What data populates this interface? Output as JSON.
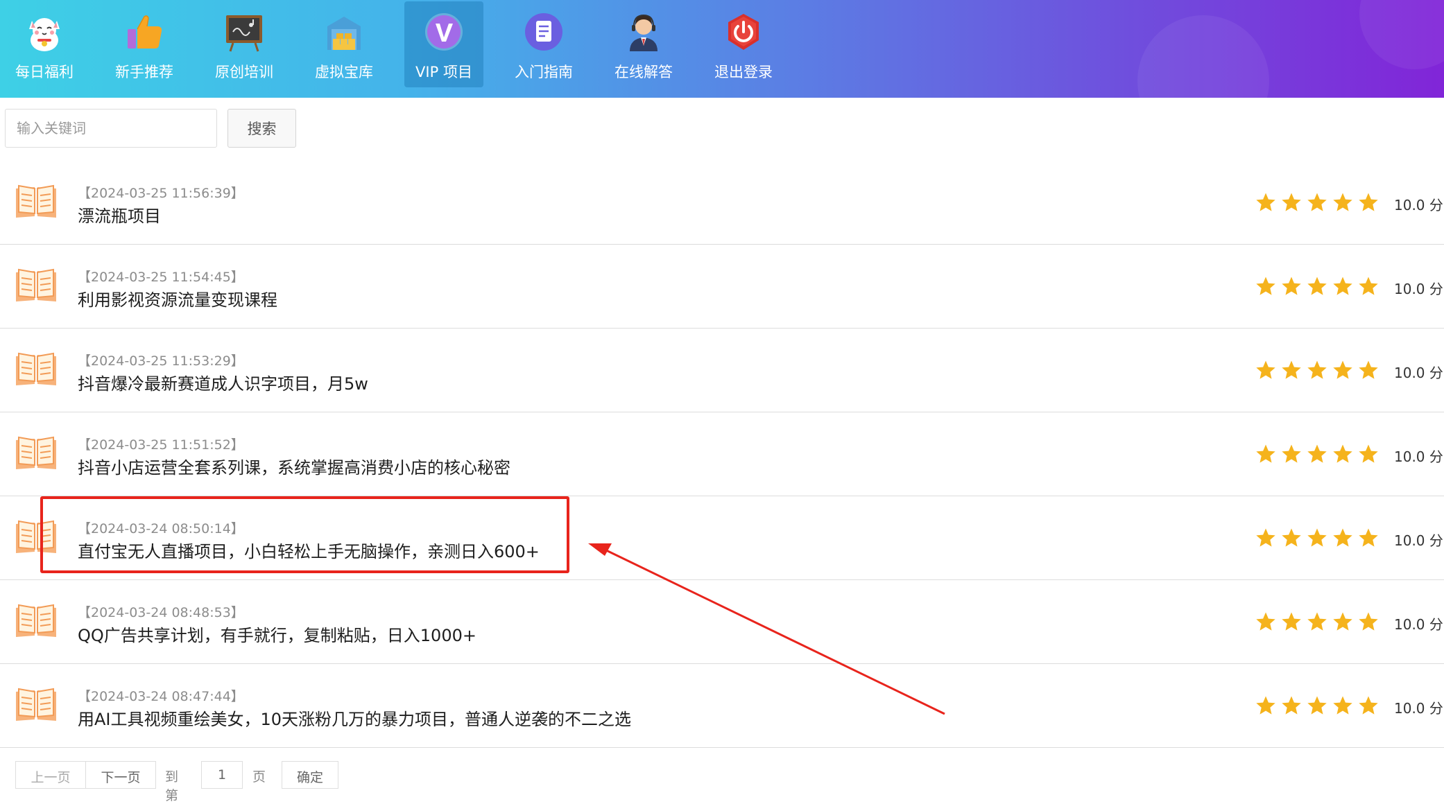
{
  "nav": {
    "items": [
      {
        "label": "每日福利",
        "icon": "lucky-cat-icon"
      },
      {
        "label": "新手推荐",
        "icon": "thumbs-up-icon"
      },
      {
        "label": "原创培训",
        "icon": "blackboard-icon"
      },
      {
        "label": "虚拟宝库",
        "icon": "warehouse-icon"
      },
      {
        "label": "VIP 项目",
        "icon": "vip-badge-icon",
        "active": true
      },
      {
        "label": "入门指南",
        "icon": "document-icon"
      },
      {
        "label": "在线解答",
        "icon": "support-agent-icon"
      },
      {
        "label": "退出登录",
        "icon": "power-icon"
      }
    ]
  },
  "search": {
    "placeholder": "输入关键词",
    "button_label": "搜索"
  },
  "list": {
    "items": [
      {
        "date": "【2024-03-25 11:56:39】",
        "title": "漂流瓶项目",
        "rating": 5,
        "score": "10.0 分"
      },
      {
        "date": "【2024-03-25 11:54:45】",
        "title": "利用影视资源流量变现课程",
        "rating": 5,
        "score": "10.0 分"
      },
      {
        "date": "【2024-03-25 11:53:29】",
        "title": "抖音爆冷最新赛道成人识字项目，月5w",
        "rating": 5,
        "score": "10.0 分"
      },
      {
        "date": "【2024-03-25 11:51:52】",
        "title": "抖音小店运营全套系列课，系统掌握高消费小店的核心秘密",
        "rating": 5,
        "score": "10.0 分"
      },
      {
        "date": "【2024-03-24 08:50:14】",
        "title": "直付宝无人直播项目，小白轻松上手无脑操作，亲测日入600+",
        "rating": 5,
        "score": "10.0 分"
      },
      {
        "date": "【2024-03-24 08:48:53】",
        "title": "QQ广告共享计划，有手就行，复制粘贴，日入1000+",
        "rating": 5,
        "score": "10.0 分"
      },
      {
        "date": "【2024-03-24 08:47:44】",
        "title": "用AI工具视频重绘美女，10天涨粉几万的暴力项目，普通人逆袭的不二之选",
        "rating": 5,
        "score": "10.0 分"
      }
    ]
  },
  "pagination": {
    "prev_label": "上一页",
    "next_label": "下一页",
    "goto_label": "到第",
    "page_value": "1",
    "page_suffix": "页",
    "confirm_label": "确定"
  },
  "colors": {
    "star": "#f5b31c",
    "annotation_red": "#e8241c",
    "nav_gradient_start": "#3ed0e6",
    "nav_gradient_end": "#8125d8"
  }
}
